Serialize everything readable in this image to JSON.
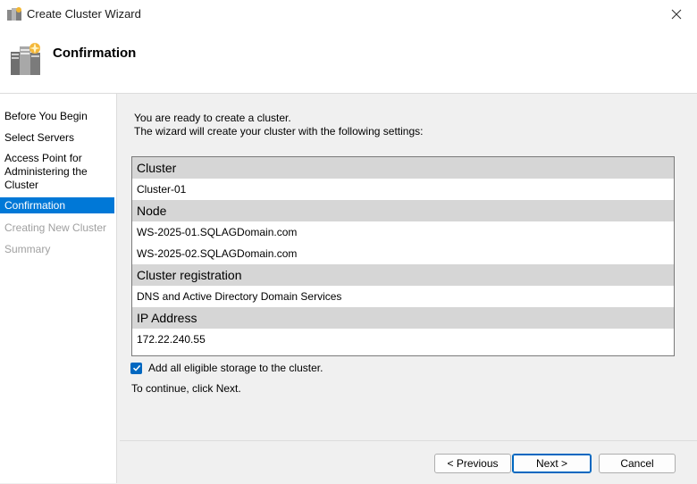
{
  "window": {
    "title": "Create Cluster Wizard"
  },
  "header": {
    "title": "Confirmation"
  },
  "sidebar": {
    "steps": [
      {
        "label": "Before You Begin"
      },
      {
        "label": "Select Servers"
      },
      {
        "label": "Access Point for Administering the Cluster"
      },
      {
        "label": "Confirmation"
      },
      {
        "label": "Creating New Cluster"
      },
      {
        "label": "Summary"
      }
    ]
  },
  "main": {
    "intro_line1": "You are ready to create a cluster.",
    "intro_line2": "The wizard will create your cluster with the following settings:",
    "settings": [
      {
        "group": "Cluster",
        "values": [
          "Cluster-01"
        ]
      },
      {
        "group": "Node",
        "values": [
          "WS-2025-01.SQLAGDomain.com",
          "WS-2025-02.SQLAGDomain.com"
        ]
      },
      {
        "group": "Cluster registration",
        "values": [
          "DNS and Active Directory Domain Services"
        ]
      },
      {
        "group": "IP Address",
        "values": [
          "172.22.240.55"
        ]
      }
    ],
    "storage_checkbox": {
      "label": "Add all eligible storage to the cluster.",
      "checked": true
    },
    "continue_text": "To continue, click Next."
  },
  "buttons": {
    "previous": "< Previous",
    "next": "Next >",
    "cancel": "Cancel"
  },
  "colors": {
    "accent": "#0078d7",
    "group_header": "#d6d6d6"
  }
}
